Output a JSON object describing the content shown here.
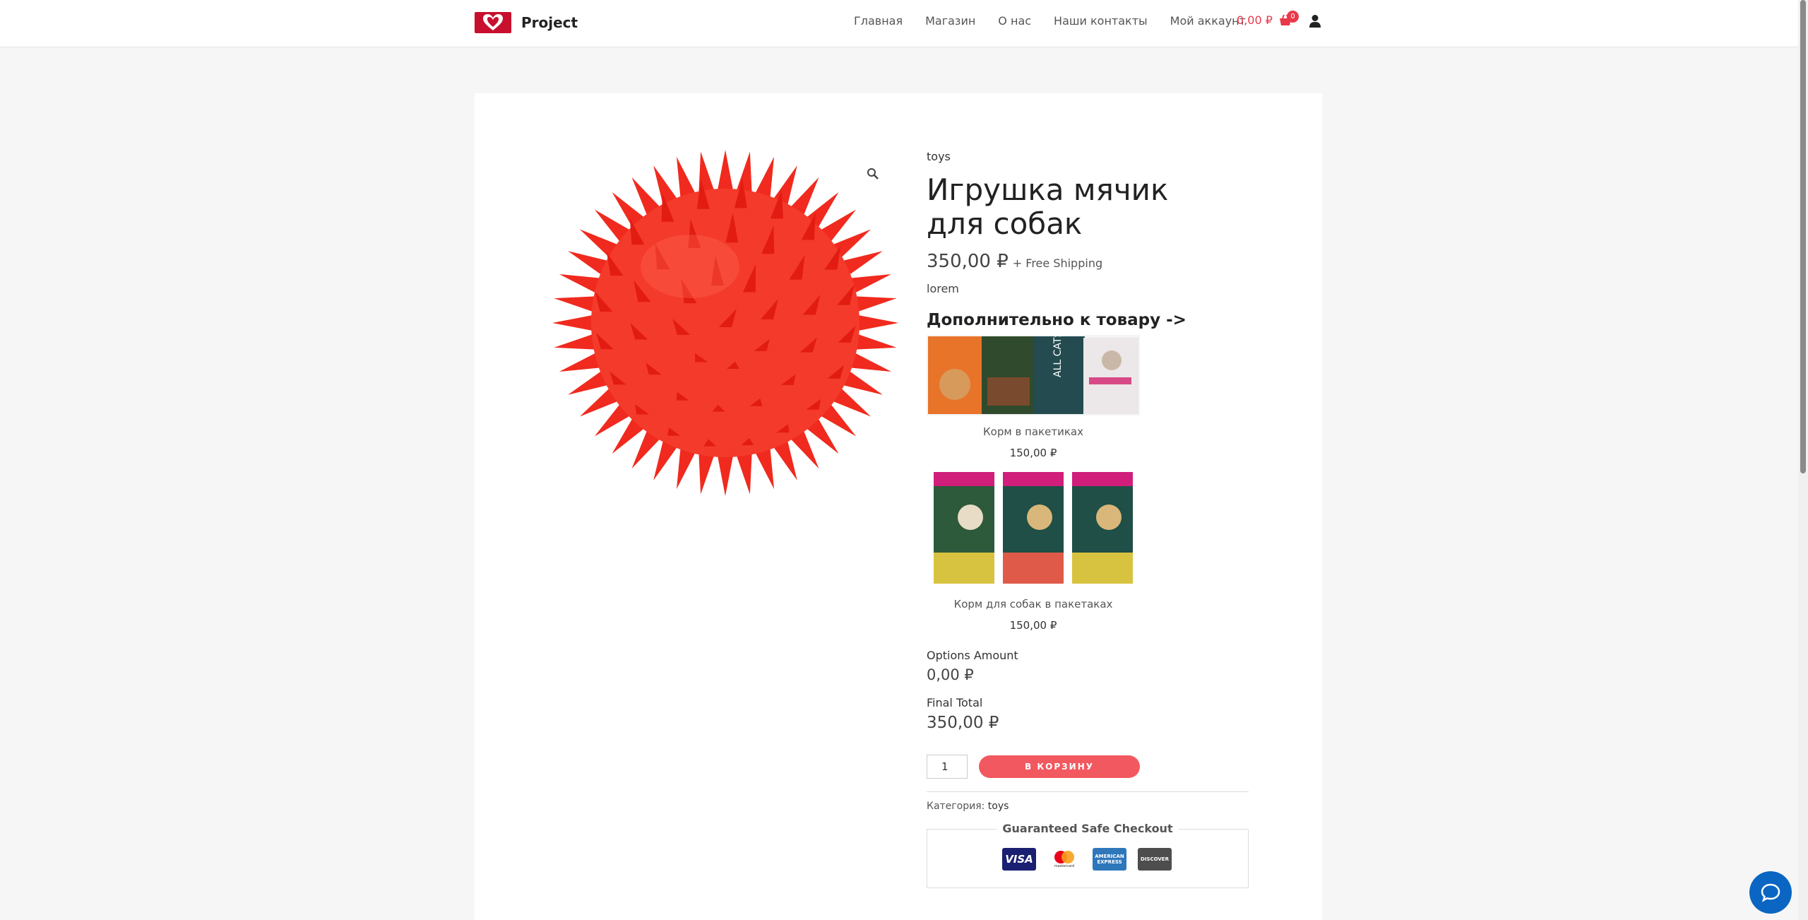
{
  "header": {
    "logo_text": "Project",
    "nav": [
      "Главная",
      "Магазин",
      "О нас",
      "Наши контакты",
      "Мой аккаунт"
    ],
    "cart_total": "0,00 ₽",
    "cart_count": "0"
  },
  "product": {
    "category": "toys",
    "title": "Игрушка мячик для собак",
    "price": "350,00 ₽",
    "shipping": "+ Free Shipping",
    "description": "lorem",
    "extras_heading": "Дополнительно к товару ->",
    "addons": [
      {
        "name": "Корм в пакетиках",
        "price": "150,00 ₽"
      },
      {
        "name": "Корм для собак в пакетаках",
        "price": "150,00 ₽"
      }
    ],
    "options_label": "Options Amount",
    "options_value": "0,00 ₽",
    "final_label": "Final Total",
    "final_value": "350,00 ₽",
    "quantity": "1",
    "add_to_cart": "В КОРЗИНУ",
    "category_label": "Категория:",
    "category_value": "toys"
  },
  "checkout": {
    "title": "Guaranteed Safe Checkout",
    "cards": [
      "VISA",
      "mastercard",
      "AMERICAN EXPRESS",
      "DISCOVER"
    ]
  },
  "colors": {
    "accent": "#e8384a",
    "button": "#f25860",
    "chat": "#0a66c2"
  }
}
